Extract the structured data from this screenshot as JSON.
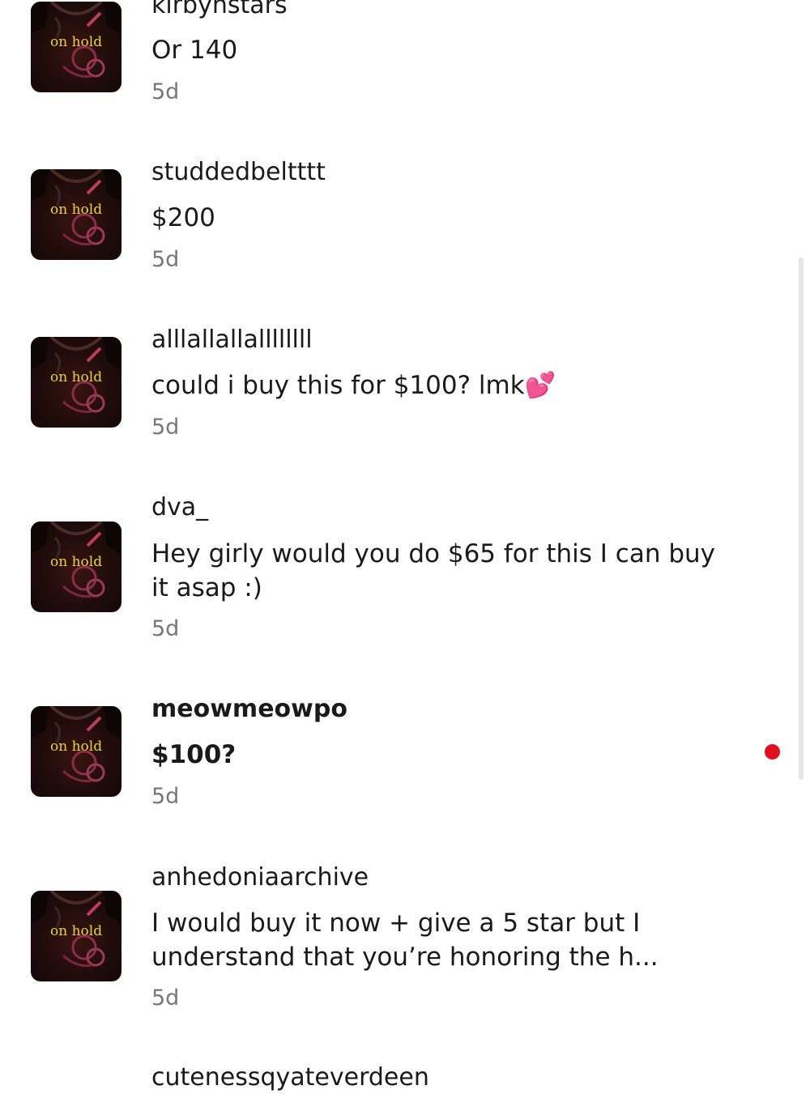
{
  "thumbnail": {
    "overlay_text": "on hold"
  },
  "threads": [
    {
      "username": "kirbynstars",
      "message": "Or 140",
      "time": "5d",
      "unread": false
    },
    {
      "username": "studdedbeltttt",
      "message": "$200",
      "time": "5d",
      "unread": false
    },
    {
      "username": "alllallallallllllll",
      "message": "could i buy this for $100? lmk💕",
      "time": "5d",
      "unread": false
    },
    {
      "username": "dva_",
      "message": "Hey girly would you do $65 for this I can buy it asap :)",
      "time": "5d",
      "unread": false
    },
    {
      "username": "meowmeowpo",
      "message": "$100?",
      "time": "5d",
      "unread": true
    },
    {
      "username": "anhedoniaarchive",
      "message": "I would buy it now + give a 5 star but I understand that you’re honoring the h...",
      "time": "5d",
      "unread": false
    },
    {
      "username": "cutenessqyateverdeen"
    }
  ],
  "colors": {
    "unread_dot": "#e0101e",
    "time_text": "#777777"
  }
}
